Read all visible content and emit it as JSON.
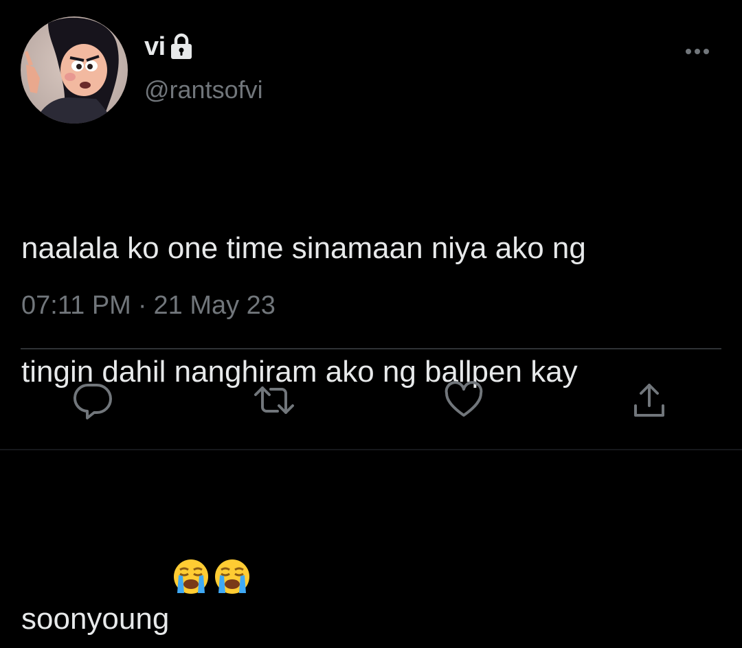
{
  "tweet": {
    "display_name": "vi",
    "handle": "@rantsofvi",
    "text_lines": [
      "naalala ko one time sinamaan niya ako ng",
      "tingin dahil nanghiram ako ng ballpen kay",
      "soonyoung"
    ],
    "emojis": [
      "loudly-crying-face",
      "loudly-crying-face"
    ],
    "time": "07:11 PM",
    "separator": "·",
    "date": "21 May 23",
    "protected_icon": "lock-icon"
  },
  "actions": {
    "reply_icon": "reply-icon",
    "retweet_icon": "retweet-icon",
    "like_icon": "heart-icon",
    "share_icon": "share-icon",
    "more_icon": "more-icon"
  },
  "colors": {
    "background": "#000000",
    "primary_text": "#e7e9ea",
    "secondary_text": "#71767b",
    "divider": "#2f3336",
    "icon": "#71767b"
  }
}
